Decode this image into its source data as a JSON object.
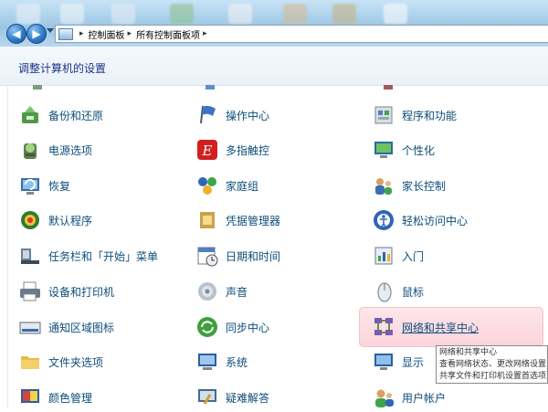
{
  "address": {
    "crumbs": [
      "控制面板",
      "所有控制面板项"
    ]
  },
  "header": {
    "title": "调整计算机的设置"
  },
  "items": [
    {
      "label": "备份和还原",
      "icon": "backup-icon"
    },
    {
      "label": "操作中心",
      "icon": "flag-icon"
    },
    {
      "label": "程序和功能",
      "icon": "programs-icon"
    },
    {
      "label": "电源选项",
      "icon": "power-icon"
    },
    {
      "label": "多指触控",
      "icon": "touch-icon"
    },
    {
      "label": "个性化",
      "icon": "personalize-icon"
    },
    {
      "label": "恢复",
      "icon": "recovery-icon"
    },
    {
      "label": "家庭组",
      "icon": "homegroup-icon"
    },
    {
      "label": "家长控制",
      "icon": "parental-icon"
    },
    {
      "label": "默认程序",
      "icon": "default-programs-icon"
    },
    {
      "label": "凭据管理器",
      "icon": "credential-icon"
    },
    {
      "label": "轻松访问中心",
      "icon": "ease-of-access-icon"
    },
    {
      "label": "任务栏和「开始」菜单",
      "icon": "taskbar-icon"
    },
    {
      "label": "日期和时间",
      "icon": "calendar-icon"
    },
    {
      "label": "入门",
      "icon": "getting-started-icon"
    },
    {
      "label": "设备和打印机",
      "icon": "printer-icon"
    },
    {
      "label": "声音",
      "icon": "speaker-icon"
    },
    {
      "label": "鼠标",
      "icon": "mouse-icon"
    },
    {
      "label": "通知区域图标",
      "icon": "notification-icon"
    },
    {
      "label": "同步中心",
      "icon": "sync-icon"
    },
    {
      "label": "网络和共享中心",
      "icon": "network-icon"
    },
    {
      "label": "文件夹选项",
      "icon": "folder-icon"
    },
    {
      "label": "系统",
      "icon": "system-icon"
    },
    {
      "label": "显示",
      "icon": "display-icon"
    },
    {
      "label": "颜色管理",
      "icon": "color-icon"
    },
    {
      "label": "疑难解答",
      "icon": "troubleshoot-icon"
    },
    {
      "label": "用户帐户",
      "icon": "user-accounts-icon"
    }
  ],
  "tooltip": {
    "title": "网络和共享中心",
    "line1": "查看网络状态、更改网络设置",
    "line2": "共享文件和打印机设置首选项"
  }
}
